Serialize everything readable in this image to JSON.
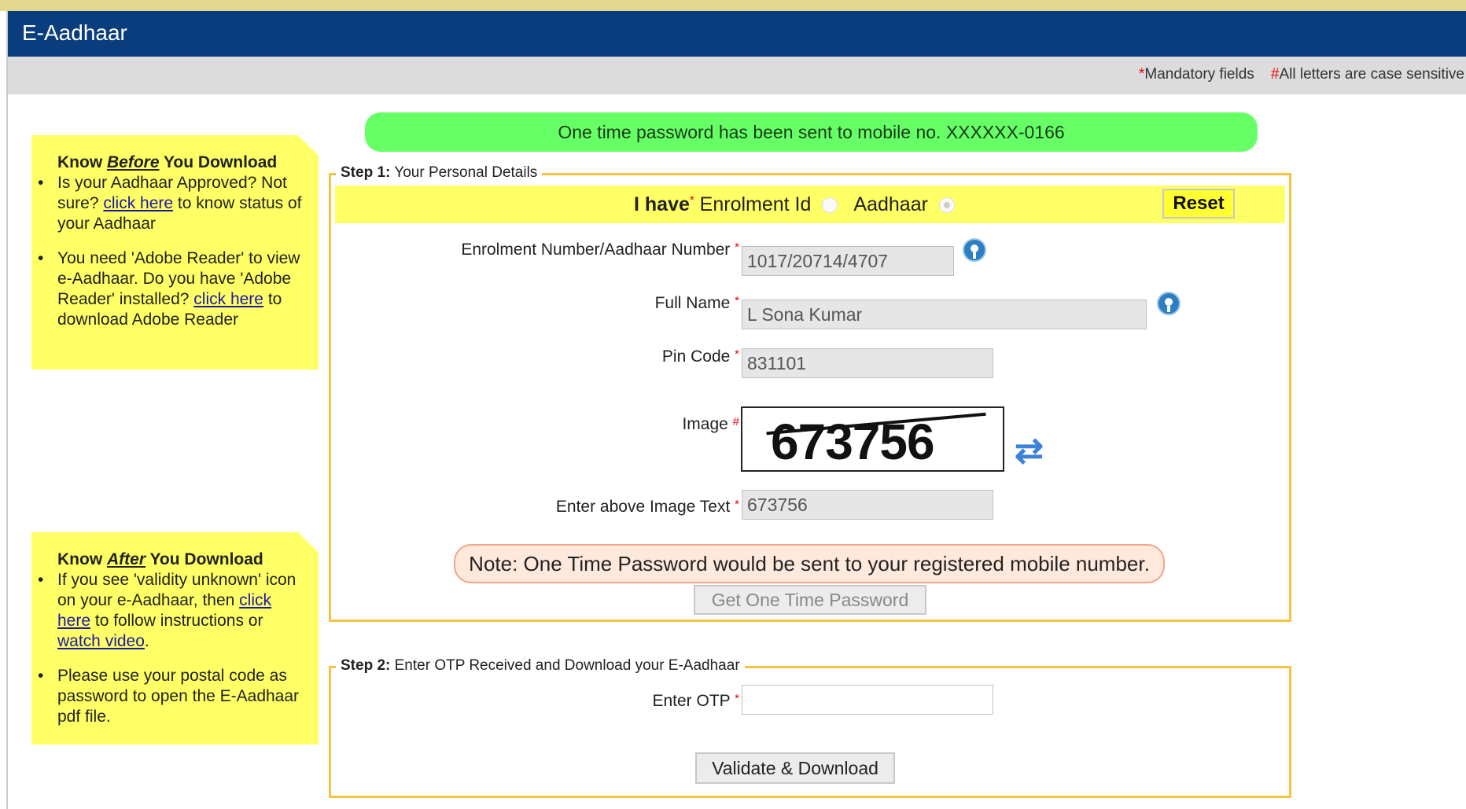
{
  "app": {
    "title": "E-Aadhaar"
  },
  "notes": {
    "mandatory_mark": "*",
    "mandatory": "Mandatory fields",
    "case_mark": "#",
    "case": "All letters are case sensitive"
  },
  "panel1": {
    "h_pre": "Know ",
    "h_em": "Before",
    "h_post": " You Download",
    "b1_pre": "Is your Aadhaar Approved? Not sure? ",
    "b1_link": "click here",
    "b1_post": " to know status of your Aadhaar",
    "b2_pre": "You need 'Adobe Reader' to view e-Aadhaar. Do you have 'Adobe Reader' installed? ",
    "b2_link": "click here",
    "b2_post": " to download Adobe Reader"
  },
  "panel2": {
    "h_pre": "Know ",
    "h_em": "After",
    "h_post": " You Download",
    "b1_pre": "If you see 'validity unknown' icon on your e-Aadhaar, then ",
    "b1_link": "click here",
    "b1_mid": " to follow instructions or ",
    "b1_link2": "watch video",
    "b1_post": ".",
    "b2": "Please use your postal code as password to open the E-Aadhaar pdf file."
  },
  "success_msg": "One time password has been sent to mobile no. XXXXXX-0166",
  "step1": {
    "legend_bold": "Step 1:",
    "legend": " Your Personal Details",
    "ihave": "I have",
    "opt_enrolment": "Enrolment Id",
    "opt_aadhaar": "Aadhaar",
    "selected": "Aadhaar",
    "reset": "Reset",
    "enrol_label": "Enrolment Number/Aadhaar Number",
    "enrol_value": "1017/20714/4707",
    "name_label": "Full Name",
    "name_value": "L Sona Kumar",
    "pin_label": "Pin Code",
    "pin_value": "831101",
    "image_label": "Image",
    "captcha": "673756",
    "image_text_label": "Enter above Image Text",
    "image_text_value": "673756",
    "note": "Note: One Time Password would be sent to your registered mobile number.",
    "otp_button": "Get One Time Password"
  },
  "step2": {
    "legend_bold": "Step 2:",
    "legend": " Enter OTP Received and Download your E-Aadhaar",
    "otp_label": "Enter OTP",
    "otp_value": "",
    "validate_button": "Validate & Download"
  },
  "colors": {
    "header": "#0a3d7e",
    "panel": "#ffff66",
    "success": "#66ff66",
    "fieldset": "#f5c542",
    "required": "#e00000"
  }
}
